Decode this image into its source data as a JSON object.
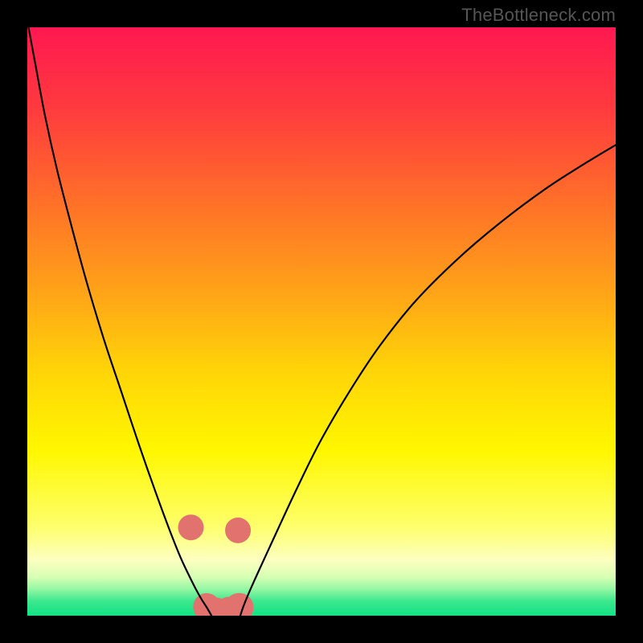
{
  "watermark": "TheBottleneck.com",
  "colors": {
    "frame": "#000000",
    "curve": "#000000",
    "markers": "#e1726e",
    "watermark": "#565656"
  },
  "chart_data": {
    "type": "line",
    "title": "",
    "xlabel": "",
    "ylabel": "",
    "xlim": [
      0,
      100
    ],
    "ylim": [
      0,
      100
    ],
    "gradient_stops": [
      {
        "pos": 0.0,
        "color": "#ff1850"
      },
      {
        "pos": 0.14,
        "color": "#ff3b3e"
      },
      {
        "pos": 0.3,
        "color": "#ff7128"
      },
      {
        "pos": 0.44,
        "color": "#ffa019"
      },
      {
        "pos": 0.58,
        "color": "#ffd308"
      },
      {
        "pos": 0.72,
        "color": "#fff700"
      },
      {
        "pos": 0.85,
        "color": "#feff6d"
      },
      {
        "pos": 0.905,
        "color": "#fdffc0"
      },
      {
        "pos": 0.935,
        "color": "#d5ffb4"
      },
      {
        "pos": 0.955,
        "color": "#95f7a4"
      },
      {
        "pos": 0.975,
        "color": "#3ce88e"
      },
      {
        "pos": 1.0,
        "color": "#12e285"
      }
    ],
    "series": [
      {
        "name": "left-branch",
        "x": [
          0.2,
          1.5,
          3.0,
          5.0,
          7.3,
          10.0,
          13.0,
          16.0,
          19.0,
          21.8,
          24.2,
          26.0,
          27.4,
          28.6,
          29.6,
          30.5,
          31.3
        ],
        "y": [
          100,
          93,
          85,
          76,
          67,
          57,
          47,
          38,
          29,
          21,
          14.5,
          10,
          7.0,
          4.6,
          2.8,
          1.4,
          0.0
        ]
      },
      {
        "name": "right-branch",
        "x": [
          36.2,
          36.7,
          37.5,
          38.6,
          40.2,
          42.5,
          46.0,
          50.0,
          55.0,
          60.0,
          66.0,
          73.0,
          80.0,
          88.0,
          95.0,
          100.0
        ],
        "y": [
          0.0,
          1.5,
          3.5,
          6.0,
          9.5,
          14.5,
          22.0,
          30.0,
          38.5,
          46.0,
          53.5,
          60.5,
          66.5,
          72.5,
          77.0,
          80.0
        ]
      }
    ],
    "markers": {
      "name": "highlight-points",
      "x": [
        27.8,
        30.5,
        32.2,
        34.2,
        36.0,
        35.8
      ],
      "y": [
        15.0,
        1.5,
        1.0,
        1.0,
        1.4,
        14.5
      ],
      "size": [
        16,
        17,
        15,
        16,
        18,
        16
      ]
    }
  }
}
